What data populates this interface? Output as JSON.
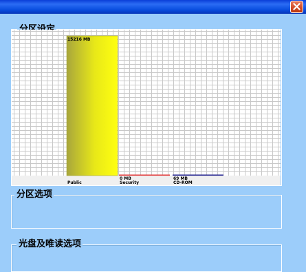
{
  "window": {
    "title": ""
  },
  "titlebar": {
    "close_icon": "close-x-icon"
  },
  "partition_group": {
    "title": "分区设定"
  },
  "options_group": {
    "title": "分区选项"
  },
  "optical_group": {
    "title": "光盘及唯读选项"
  },
  "colors": {
    "background": "#9ccdfa",
    "titlebar": "#0a4ee0",
    "public_bar": "#f5f50f",
    "security_line": "#e03030",
    "cdrom_line": "#1a1a8a"
  },
  "chart_data": {
    "type": "bar",
    "categories": [
      "Public",
      "Security",
      "CD-ROM"
    ],
    "values": [
      15216,
      0,
      69
    ],
    "data_labels": [
      "15216 MB",
      "0 MB",
      "69 MB"
    ],
    "ylim": [
      0,
      15216
    ],
    "grid": true,
    "colors": [
      "#f5f50f",
      "#e03030",
      "#1a1a8a"
    ]
  }
}
